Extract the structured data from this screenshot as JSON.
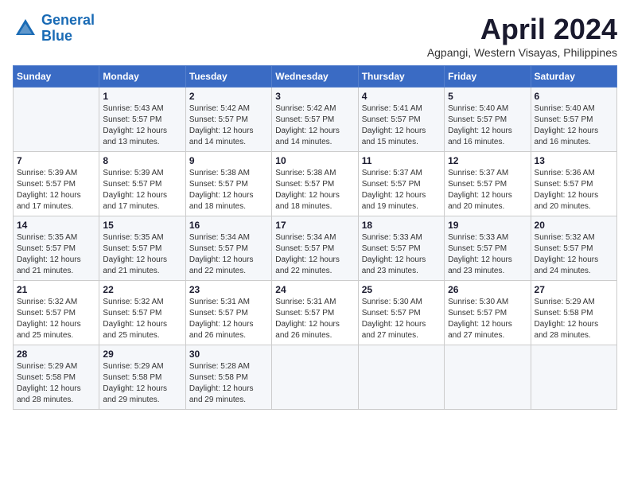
{
  "header": {
    "logo_line1": "General",
    "logo_line2": "Blue",
    "month": "April 2024",
    "location": "Agpangi, Western Visayas, Philippines"
  },
  "days_of_week": [
    "Sunday",
    "Monday",
    "Tuesday",
    "Wednesday",
    "Thursday",
    "Friday",
    "Saturday"
  ],
  "weeks": [
    [
      {
        "day": "",
        "sunrise": "",
        "sunset": "",
        "daylight": ""
      },
      {
        "day": "1",
        "sunrise": "Sunrise: 5:43 AM",
        "sunset": "Sunset: 5:57 PM",
        "daylight": "Daylight: 12 hours and 13 minutes."
      },
      {
        "day": "2",
        "sunrise": "Sunrise: 5:42 AM",
        "sunset": "Sunset: 5:57 PM",
        "daylight": "Daylight: 12 hours and 14 minutes."
      },
      {
        "day": "3",
        "sunrise": "Sunrise: 5:42 AM",
        "sunset": "Sunset: 5:57 PM",
        "daylight": "Daylight: 12 hours and 14 minutes."
      },
      {
        "day": "4",
        "sunrise": "Sunrise: 5:41 AM",
        "sunset": "Sunset: 5:57 PM",
        "daylight": "Daylight: 12 hours and 15 minutes."
      },
      {
        "day": "5",
        "sunrise": "Sunrise: 5:40 AM",
        "sunset": "Sunset: 5:57 PM",
        "daylight": "Daylight: 12 hours and 16 minutes."
      },
      {
        "day": "6",
        "sunrise": "Sunrise: 5:40 AM",
        "sunset": "Sunset: 5:57 PM",
        "daylight": "Daylight: 12 hours and 16 minutes."
      }
    ],
    [
      {
        "day": "7",
        "sunrise": "Sunrise: 5:39 AM",
        "sunset": "Sunset: 5:57 PM",
        "daylight": "Daylight: 12 hours and 17 minutes."
      },
      {
        "day": "8",
        "sunrise": "Sunrise: 5:39 AM",
        "sunset": "Sunset: 5:57 PM",
        "daylight": "Daylight: 12 hours and 17 minutes."
      },
      {
        "day": "9",
        "sunrise": "Sunrise: 5:38 AM",
        "sunset": "Sunset: 5:57 PM",
        "daylight": "Daylight: 12 hours and 18 minutes."
      },
      {
        "day": "10",
        "sunrise": "Sunrise: 5:38 AM",
        "sunset": "Sunset: 5:57 PM",
        "daylight": "Daylight: 12 hours and 18 minutes."
      },
      {
        "day": "11",
        "sunrise": "Sunrise: 5:37 AM",
        "sunset": "Sunset: 5:57 PM",
        "daylight": "Daylight: 12 hours and 19 minutes."
      },
      {
        "day": "12",
        "sunrise": "Sunrise: 5:37 AM",
        "sunset": "Sunset: 5:57 PM",
        "daylight": "Daylight: 12 hours and 20 minutes."
      },
      {
        "day": "13",
        "sunrise": "Sunrise: 5:36 AM",
        "sunset": "Sunset: 5:57 PM",
        "daylight": "Daylight: 12 hours and 20 minutes."
      }
    ],
    [
      {
        "day": "14",
        "sunrise": "Sunrise: 5:35 AM",
        "sunset": "Sunset: 5:57 PM",
        "daylight": "Daylight: 12 hours and 21 minutes."
      },
      {
        "day": "15",
        "sunrise": "Sunrise: 5:35 AM",
        "sunset": "Sunset: 5:57 PM",
        "daylight": "Daylight: 12 hours and 21 minutes."
      },
      {
        "day": "16",
        "sunrise": "Sunrise: 5:34 AM",
        "sunset": "Sunset: 5:57 PM",
        "daylight": "Daylight: 12 hours and 22 minutes."
      },
      {
        "day": "17",
        "sunrise": "Sunrise: 5:34 AM",
        "sunset": "Sunset: 5:57 PM",
        "daylight": "Daylight: 12 hours and 22 minutes."
      },
      {
        "day": "18",
        "sunrise": "Sunrise: 5:33 AM",
        "sunset": "Sunset: 5:57 PM",
        "daylight": "Daylight: 12 hours and 23 minutes."
      },
      {
        "day": "19",
        "sunrise": "Sunrise: 5:33 AM",
        "sunset": "Sunset: 5:57 PM",
        "daylight": "Daylight: 12 hours and 23 minutes."
      },
      {
        "day": "20",
        "sunrise": "Sunrise: 5:32 AM",
        "sunset": "Sunset: 5:57 PM",
        "daylight": "Daylight: 12 hours and 24 minutes."
      }
    ],
    [
      {
        "day": "21",
        "sunrise": "Sunrise: 5:32 AM",
        "sunset": "Sunset: 5:57 PM",
        "daylight": "Daylight: 12 hours and 25 minutes."
      },
      {
        "day": "22",
        "sunrise": "Sunrise: 5:32 AM",
        "sunset": "Sunset: 5:57 PM",
        "daylight": "Daylight: 12 hours and 25 minutes."
      },
      {
        "day": "23",
        "sunrise": "Sunrise: 5:31 AM",
        "sunset": "Sunset: 5:57 PM",
        "daylight": "Daylight: 12 hours and 26 minutes."
      },
      {
        "day": "24",
        "sunrise": "Sunrise: 5:31 AM",
        "sunset": "Sunset: 5:57 PM",
        "daylight": "Daylight: 12 hours and 26 minutes."
      },
      {
        "day": "25",
        "sunrise": "Sunrise: 5:30 AM",
        "sunset": "Sunset: 5:57 PM",
        "daylight": "Daylight: 12 hours and 27 minutes."
      },
      {
        "day": "26",
        "sunrise": "Sunrise: 5:30 AM",
        "sunset": "Sunset: 5:57 PM",
        "daylight": "Daylight: 12 hours and 27 minutes."
      },
      {
        "day": "27",
        "sunrise": "Sunrise: 5:29 AM",
        "sunset": "Sunset: 5:58 PM",
        "daylight": "Daylight: 12 hours and 28 minutes."
      }
    ],
    [
      {
        "day": "28",
        "sunrise": "Sunrise: 5:29 AM",
        "sunset": "Sunset: 5:58 PM",
        "daylight": "Daylight: 12 hours and 28 minutes."
      },
      {
        "day": "29",
        "sunrise": "Sunrise: 5:29 AM",
        "sunset": "Sunset: 5:58 PM",
        "daylight": "Daylight: 12 hours and 29 minutes."
      },
      {
        "day": "30",
        "sunrise": "Sunrise: 5:28 AM",
        "sunset": "Sunset: 5:58 PM",
        "daylight": "Daylight: 12 hours and 29 minutes."
      },
      {
        "day": "",
        "sunrise": "",
        "sunset": "",
        "daylight": ""
      },
      {
        "day": "",
        "sunrise": "",
        "sunset": "",
        "daylight": ""
      },
      {
        "day": "",
        "sunrise": "",
        "sunset": "",
        "daylight": ""
      },
      {
        "day": "",
        "sunrise": "",
        "sunset": "",
        "daylight": ""
      }
    ]
  ]
}
